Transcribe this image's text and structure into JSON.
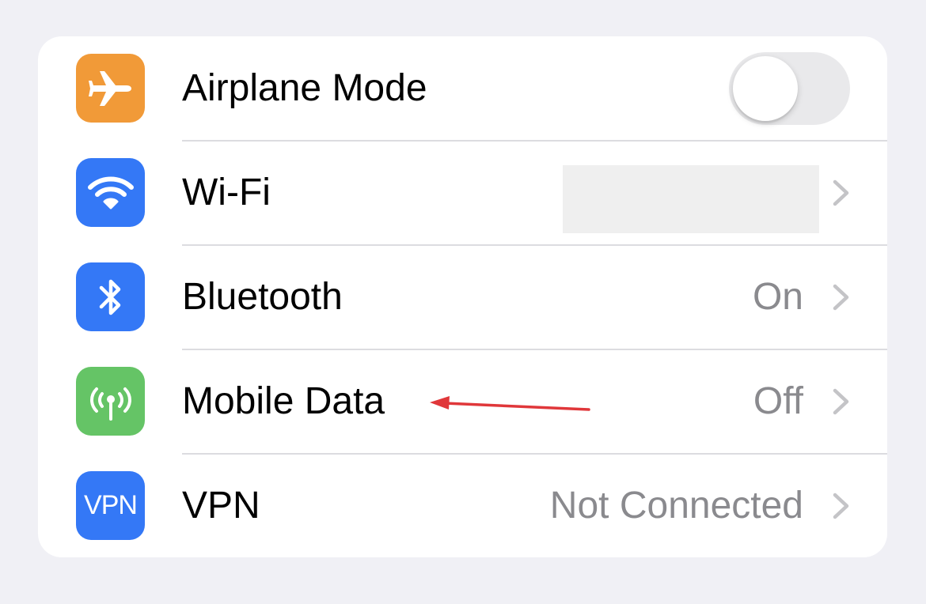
{
  "colors": {
    "airplane_tile": "#f19a38",
    "wifi_tile": "#3478f6",
    "bluetooth_tile": "#3478f6",
    "mobile_data_tile": "#65c466",
    "vpn_tile": "#3478f6",
    "annotation_arrow": "#e0373a"
  },
  "rows": [
    {
      "icon": "airplane-icon",
      "label": "Airplane Mode",
      "control": "toggle",
      "toggle_on": false
    },
    {
      "icon": "wifi-icon",
      "label": "Wi-Fi",
      "value": "",
      "value_redacted": true
    },
    {
      "icon": "bluetooth-icon",
      "label": "Bluetooth",
      "value": "On"
    },
    {
      "icon": "antenna-icon",
      "label": "Mobile Data",
      "value": "Off",
      "annotated": true
    },
    {
      "icon": "vpn-icon",
      "icon_text": "VPN",
      "label": "VPN",
      "value": "Not Connected"
    }
  ]
}
